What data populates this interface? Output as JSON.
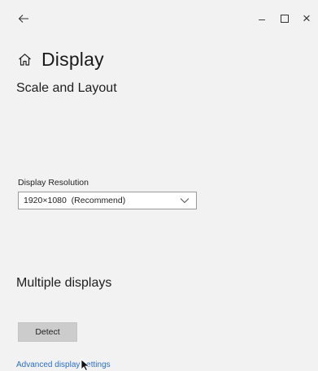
{
  "window": {
    "back_icon": "back-arrow-icon",
    "minimize_label": "–",
    "maximize_icon": "maximize-icon",
    "close_label": "×"
  },
  "header": {
    "home_icon": "home-icon",
    "title": "Display"
  },
  "scale_layout": {
    "section_title": "Scale and Layout",
    "resolution_label": "Display Resolution",
    "resolution_value": "1920×1080  (Recommend)",
    "chevron_icon": "chevron-down-icon"
  },
  "multiple_displays": {
    "section_title": "Multiple displays",
    "detect_label": "Detect",
    "advanced_link": "Advanced display settings"
  },
  "colors": {
    "background": "#f2f2f2",
    "link": "#2a6fc9",
    "button": "#cccccc"
  }
}
